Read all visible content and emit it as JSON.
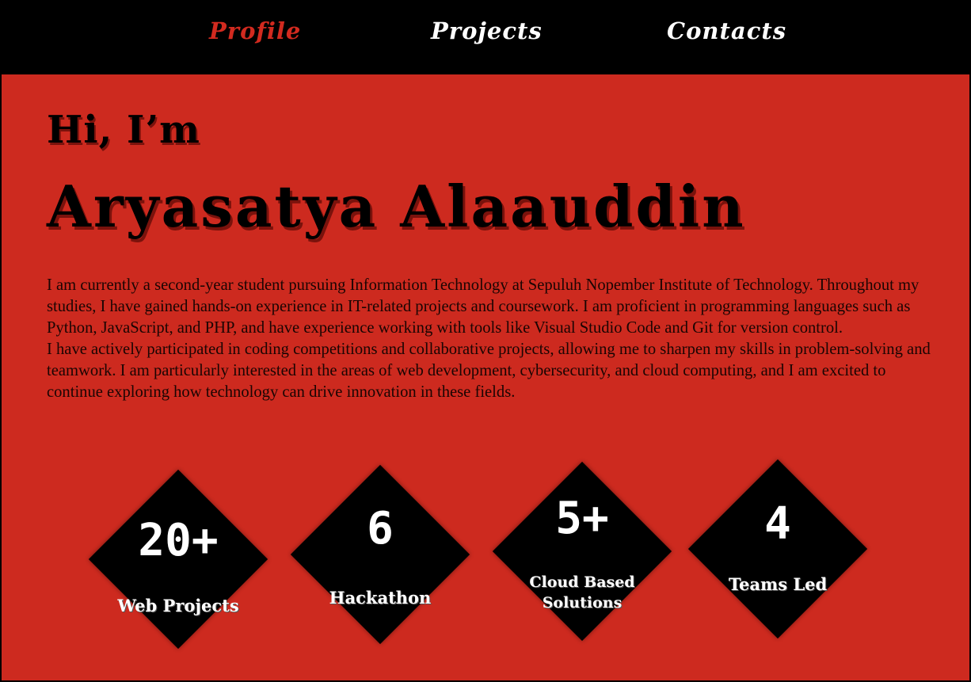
{
  "nav": {
    "items": [
      {
        "label": "Profile",
        "active": true
      },
      {
        "label": "Projects",
        "active": false
      },
      {
        "label": "Contacts",
        "active": false
      }
    ]
  },
  "hero": {
    "greeting": "Hi, I’m",
    "name": "Aryasatya Alaauddin"
  },
  "bio": {
    "paragraphs": [
      "I am currently a second-year student pursuing Information Technology at Sepuluh Nopember Institute of Technology. Throughout my studies, I have gained hands-on experience in IT-related projects and coursework. I am proficient in programming languages such as Python, JavaScript, and PHP, and have experience working with tools like Visual Studio Code and Git for version control.",
      "I have actively participated in coding competitions and collaborative projects, allowing me to sharpen my skills in problem-solving and teamwork. I am particularly interested in the areas of web development, cybersecurity, and cloud computing, and I am excited to continue exploring how technology can drive innovation in these fields."
    ]
  },
  "stats": [
    {
      "value": "20+",
      "label": "Web Projects"
    },
    {
      "value": "6",
      "label": "Hackathon"
    },
    {
      "value": "5+",
      "label": "Cloud Based Solutions"
    },
    {
      "value": "4",
      "label": "Teams Led"
    }
  ],
  "colors": {
    "background": "#cd2a1f",
    "nav_background": "#000000",
    "nav_active": "#d22a1f",
    "text_light": "#ffffff",
    "text_dark": "#000000"
  }
}
